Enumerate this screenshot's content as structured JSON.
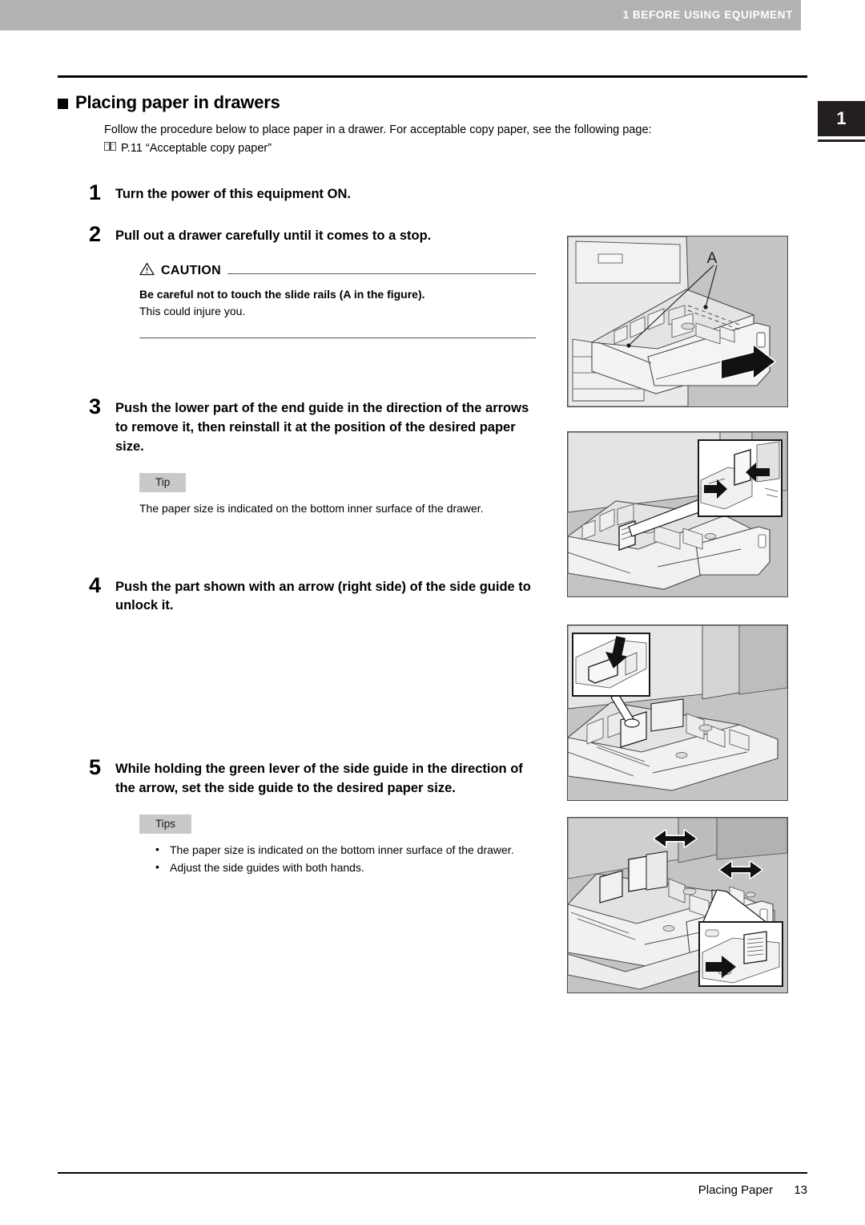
{
  "header": {
    "running_title": "1 BEFORE USING EQUIPMENT",
    "chapter_tab": "1"
  },
  "section": {
    "title": "Placing paper in drawers",
    "intro": "Follow the procedure below to place paper in a drawer. For acceptable copy paper, see the following page:",
    "xref": "P.11 “Acceptable copy paper”",
    "xref_icon": "book-icon"
  },
  "steps": [
    {
      "number": "1",
      "text": "Turn the power of this equipment ON."
    },
    {
      "number": "2",
      "text": "Pull out a drawer carefully until it comes to a stop."
    },
    {
      "number": "3",
      "text": "Push the lower part of the end guide in the direction of the arrows to remove it, then reinstall it at the position of the desired paper size."
    },
    {
      "number": "4",
      "text": "Push the part shown with an arrow (right side) of the side guide to unlock it."
    },
    {
      "number": "5",
      "text": "While holding the green lever of the side guide in the direction of the arrow, set the side guide to the desired paper size."
    }
  ],
  "caution": {
    "label": "CAUTION",
    "icon": "warning-triangle-icon",
    "line_bold": "Be careful not to touch the slide rails (A in the figure).",
    "line_plain": "This could injure you."
  },
  "tip_step3": {
    "badge": "Tip",
    "body": "The paper size is indicated on the bottom inner surface of the drawer."
  },
  "tips_step5": {
    "badge": "Tips",
    "items": [
      "The paper size is indicated on the bottom inner surface of the drawer.",
      "Adjust the side guides with both hands."
    ]
  },
  "figures": {
    "fig_step2": {
      "name": "drawer-pulled-out-illustration",
      "callout_label": "A",
      "description": "Copier with paper drawer pulled out, arrow pointing out, slide rails labeled A"
    },
    "fig_step3": {
      "name": "end-guide-illustration",
      "description": "Open drawer with detail inset showing end guide being pushed by two arrows"
    },
    "fig_step4": {
      "name": "side-guide-unlock-illustration",
      "description": "Open drawer with detail inset showing a downward arrow pressing the side guide lock"
    },
    "fig_step5": {
      "name": "side-guide-adjust-illustration",
      "description": "Open drawer with two double-headed arrows and detail inset of the green lever being pushed"
    }
  },
  "footer": {
    "title": "Placing Paper",
    "page": "13"
  },
  "colors": {
    "header_bar": "#b3b3b3",
    "chapter_tab": "#231f20",
    "tip_badge": "#c9c9c9",
    "figure_bg": "#c4c4c4",
    "figure_border": "#4a4a4a"
  }
}
